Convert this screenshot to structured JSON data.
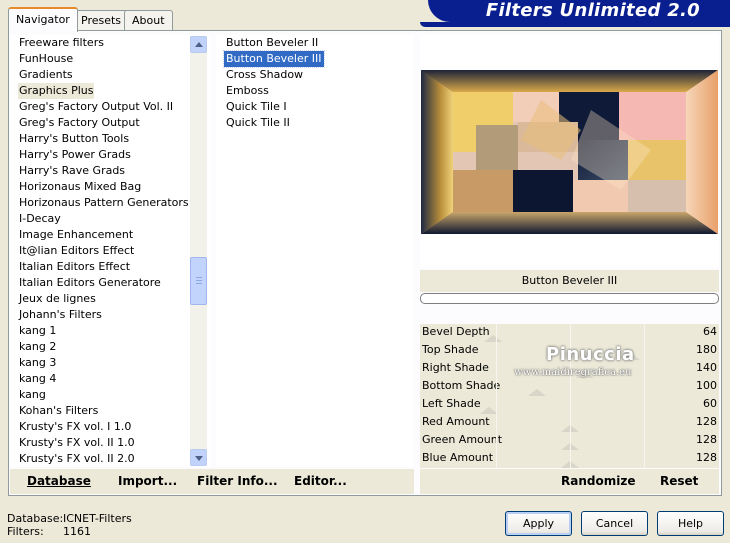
{
  "tabs": [
    "Navigator",
    "Presets",
    "About"
  ],
  "app_title": "Filters Unlimited 2.0",
  "categories": [
    "Freeware filters",
    "FunHouse",
    "Gradients",
    "Graphics Plus",
    "Greg's Factory Output Vol. II",
    "Greg's Factory Output",
    "Harry's Button Tools",
    "Harry's Power Grads",
    "Harry's Rave Grads",
    "Horizonaus Mixed Bag",
    "Horizonaus Pattern Generators",
    "I-Decay",
    "Image Enhancement",
    "It@lian Editors Effect",
    "Italian Editors Effect",
    "Italian Editors Generatore",
    "Jeux de lignes",
    "Johann's Filters",
    "kang 1",
    "kang 2",
    "kang 3",
    "kang 4",
    "kang",
    "Kohan's Filters",
    "Krusty's FX vol. I 1.0",
    "Krusty's FX vol. II 1.0",
    "Krusty's FX vol. II 2.0"
  ],
  "selected_category": "Graphics Plus",
  "filters": [
    "Button Beveler II",
    "Button Beveler III",
    "Cross Shadow",
    "Emboss",
    "Quick Tile I",
    "Quick Tile II"
  ],
  "selected_filter": "Button Beveler III",
  "preview_filter_name": "Button Beveler III",
  "params": [
    {
      "label": "Bevel Depth",
      "value": "64"
    },
    {
      "label": "Top Shade",
      "value": "180"
    },
    {
      "label": "Right Shade",
      "value": "140"
    },
    {
      "label": "Bottom Shade",
      "value": "100"
    },
    {
      "label": "Left Shade",
      "value": "60"
    },
    {
      "label": "Red Amount",
      "value": "128"
    },
    {
      "label": "Green Amount",
      "value": "128"
    },
    {
      "label": "Blue Amount",
      "value": "128"
    }
  ],
  "watermark": {
    "name": "Pinuccia",
    "url": "www.maidiregrafica.eu"
  },
  "toolbar": {
    "database": "Database",
    "import": "Import...",
    "filter_info": "Filter Info...",
    "editor": "Editor...",
    "randomize": "Randomize",
    "reset": "Reset"
  },
  "footer": {
    "database_label": "Database:",
    "database_value": "ICNET-Filters",
    "filters_label": "Filters:",
    "filters_value": "1161"
  },
  "buttons": {
    "apply": "Apply",
    "cancel": "Cancel",
    "help": "Help"
  },
  "colors": {
    "banner": "#0a1f8f",
    "selection": "#316ac5",
    "tab_highlight": "#e68b2c"
  }
}
